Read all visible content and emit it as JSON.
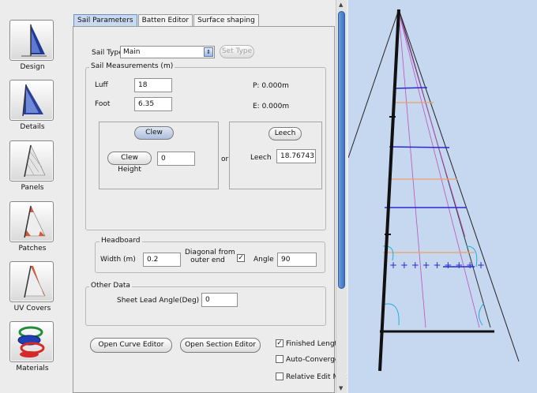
{
  "nav": {
    "items": [
      {
        "label": "Design",
        "icon": "sail-design-icon"
      },
      {
        "label": "Details",
        "icon": "sail-details-icon"
      },
      {
        "label": "Panels",
        "icon": "sail-panels-icon"
      },
      {
        "label": "Patches",
        "icon": "sail-patches-icon"
      },
      {
        "label": "UV Covers",
        "icon": "sail-uv-covers-icon"
      },
      {
        "label": "Materials",
        "icon": "materials-icon"
      }
    ]
  },
  "tabs": [
    {
      "label": "Sail Parameters",
      "active": true
    },
    {
      "label": "Batten Editor",
      "active": false
    },
    {
      "label": "Surface shaping",
      "active": false
    }
  ],
  "sail_type": {
    "label": "Sail Type",
    "value": "Main",
    "set_button": "Set Type"
  },
  "measurements": {
    "legend": "Sail Measurements (m)",
    "luff_label": "Luff",
    "luff_value": "18",
    "foot_label": "Foot",
    "foot_value": "6.35",
    "p_text": "P: 0.000m",
    "e_text": "E: 0.000m",
    "clew_button": "Clew",
    "clew_height_button": "Clew Height",
    "clew_height_value": "0",
    "or_text": "or",
    "leech_button": "Leech",
    "leech_label": "Leech",
    "leech_value": "18.76743"
  },
  "headboard": {
    "legend": "Headboard",
    "width_label": "Width (m)",
    "width_value": "0.2",
    "diagonal_label_1": "Diagonal from",
    "diagonal_label_2": "outer end",
    "diagonal_checked": "✓",
    "angle_label": "Angle",
    "angle_value": "90"
  },
  "other": {
    "legend": "Other Data",
    "sheet_lead_label": "Sheet Lead Angle(Deg)",
    "sheet_lead_value": "0"
  },
  "bottom": {
    "curve_editor_button": "Open Curve Editor",
    "section_editor_button": "Open Section Editor",
    "finished_lengths_label": "Finished Lengths",
    "finished_lengths_checked": "✓",
    "auto_converge_label": "Auto-Converge",
    "relative_edit_label": "Relative Edit Moc"
  },
  "colors": {
    "view_background": "#c6d7f0",
    "batten_blue": "#2a2ad0",
    "batten_orange": "#f0a060",
    "seam_magenta": "#c050c0",
    "patch_cyan": "#20b0d0"
  }
}
